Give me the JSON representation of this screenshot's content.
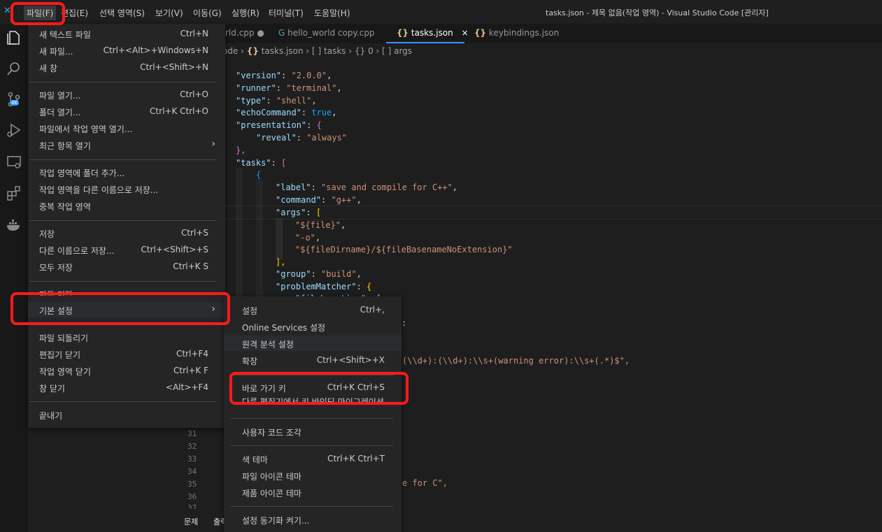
{
  "window_title": "tasks.json - 제목 없음(작업 영역) - Visual Studio Code [관리자]",
  "menubar": [
    "파일(F)",
    "편집(E)",
    "선택 영역(S)",
    "보기(V)",
    "이동(G)",
    "실행(R)",
    "터미널(T)",
    "도움말(H)"
  ],
  "tabs": [
    {
      "label": "rld.cpp",
      "dot": "●"
    },
    {
      "label": "hello_world copy.cpp"
    },
    {
      "label": "tasks.json",
      "close": "×"
    },
    {
      "label": "keybindings.json"
    }
  ],
  "breadcrumb": [
    "ode",
    "tasks.json",
    "tasks",
    "0",
    "args"
  ],
  "code": {
    "l1": [
      "\"version\"",
      ": ",
      "\"2.0.0\"",
      ","
    ],
    "l2": [
      "\"runner\"",
      ": ",
      "\"terminal\"",
      ","
    ],
    "l3": [
      "\"type\"",
      ": ",
      "\"shell\"",
      ","
    ],
    "l4": [
      "\"echoCommand\"",
      ": ",
      "true",
      ","
    ],
    "l5": [
      "\"presentation\"",
      ": ",
      "{"
    ],
    "l6": [
      "\"reveal\"",
      ": ",
      "\"always\""
    ],
    "l7": "},",
    "l8": [
      "\"tasks\"",
      ": ",
      "["
    ],
    "l9": "{",
    "l10": [
      "\"label\"",
      ": ",
      "\"save and compile for C++\"",
      ","
    ],
    "l11": [
      "\"command\"",
      ": ",
      "\"g++\"",
      ","
    ],
    "l12": [
      "\"args\"",
      ": ",
      "["
    ],
    "l13": [
      "\"${file}\"",
      ","
    ],
    "l14": [
      "\"-o\"",
      ","
    ],
    "l15": [
      "\"${fileDirname}/${fileBasenameNoExtension}\""
    ],
    "l16": "],",
    "l17": [
      "\"group\"",
      ": ",
      "\"build\"",
      ","
    ],
    "l18": [
      "\"problemMatcher\"",
      ": ",
      "{"
    ],
    "l19": "\"fileLocation\": [",
    "l20": ":",
    "l21": "(\\\\d+):(\\\\d+):\\\\s+(warning error):\\\\s+(.*)$\",",
    "l22": "e for C\","
  },
  "line_numbers": [
    "31",
    "32",
    "33",
    "34",
    "35",
    "36",
    "37"
  ],
  "file_menu": [
    {
      "label": "새 텍스트 파일",
      "shortcut": "Ctrl+N"
    },
    {
      "label": "새 파일...",
      "shortcut": "Ctrl+<Alt>+Windows+N"
    },
    {
      "label": "새 창",
      "shortcut": "Ctrl+<Shift>+N"
    },
    {
      "label": "파일 열기...",
      "shortcut": "Ctrl+O"
    },
    {
      "label": "폴더 열기...",
      "shortcut": "Ctrl+K Ctrl+O"
    },
    {
      "label": "파일에서 작업 영역 열기..."
    },
    {
      "label": "최근 항목 열기",
      "arrow": "›"
    },
    {
      "label": "작업 영역에 폴더 추가..."
    },
    {
      "label": "작업 영역을 다른 이름으로 저장..."
    },
    {
      "label": "중복 작업 영역"
    },
    {
      "label": "저장",
      "shortcut": "Ctrl+S"
    },
    {
      "label": "다른 이름으로 저장...",
      "shortcut": "Ctrl+<Shift>+S"
    },
    {
      "label": "모두 저장",
      "shortcut": "Ctrl+K S"
    },
    {
      "label": "자동 저장"
    },
    {
      "label": "기본 설정",
      "arrow": "›"
    },
    {
      "label": "파일 되돌리기"
    },
    {
      "label": "편집기 닫기",
      "shortcut": "Ctrl+F4"
    },
    {
      "label": "작업 영역 닫기",
      "shortcut": "Ctrl+K F"
    },
    {
      "label": "창 닫기",
      "shortcut": "<Alt>+F4"
    },
    {
      "label": "끝내기"
    }
  ],
  "pref_menu": [
    {
      "label": "설정",
      "shortcut": "Ctrl+,"
    },
    {
      "label": "Online Services 설정"
    },
    {
      "label": "원격 분석 설정"
    },
    {
      "label": "확장",
      "shortcut": "Ctrl+<Shift>+X"
    },
    {
      "label": "바로 가기 키",
      "shortcut": "Ctrl+K Ctrl+S"
    },
    {
      "label": "다른 편집기에서 키 바인딩 마이그레이션..."
    },
    {
      "label": "사용자 코드 조각"
    },
    {
      "label": "색 테마",
      "shortcut": "Ctrl+K Ctrl+T"
    },
    {
      "label": "파일 아이콘 테마"
    },
    {
      "label": "제품 아이콘 테마"
    },
    {
      "label": "설정 동기화 켜기..."
    }
  ],
  "panel_tabs": [
    "문제",
    "출력"
  ],
  "activity_badge": "4K",
  "colors": {
    "accent_blue": "#3794ff",
    "callout_red": "#ff1a1a"
  }
}
